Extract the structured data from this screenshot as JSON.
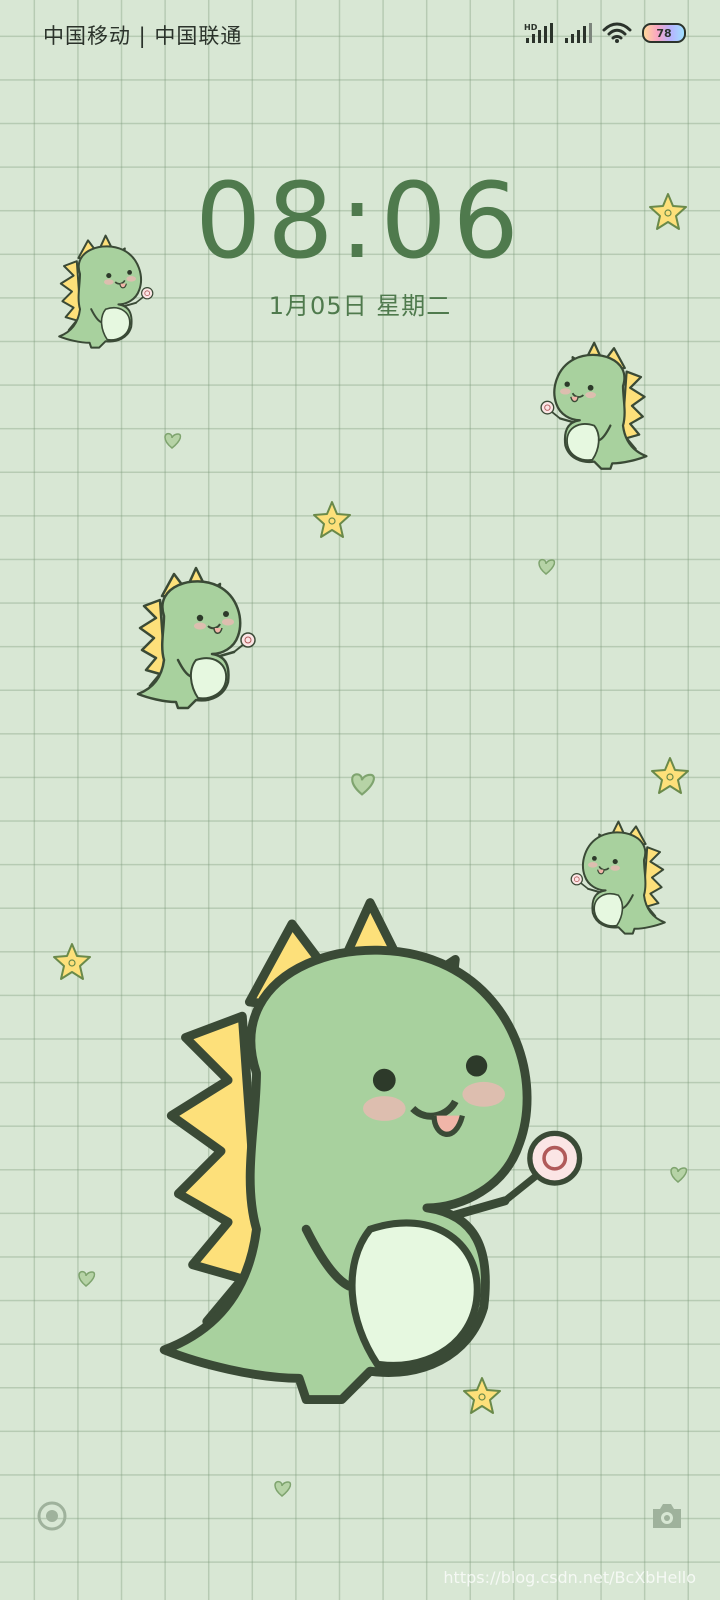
{
  "status_bar": {
    "carrier_text": "中国移动 | 中国联通",
    "signal_1_label": "HD",
    "battery_level": "78"
  },
  "lockscreen": {
    "time": "08:06",
    "date": "1月05日 星期二"
  },
  "shortcuts": {
    "left_icon": "record-icon",
    "right_icon": "camera-icon"
  },
  "watermark": "https://blog.csdn.net/BcXbHello",
  "colors": {
    "background": "#d8e7d4",
    "clock": "#4f7a4d",
    "dino_body": "#a8d19e",
    "dino_spikes": "#fde07a",
    "dino_belly": "#e6f8e0"
  }
}
